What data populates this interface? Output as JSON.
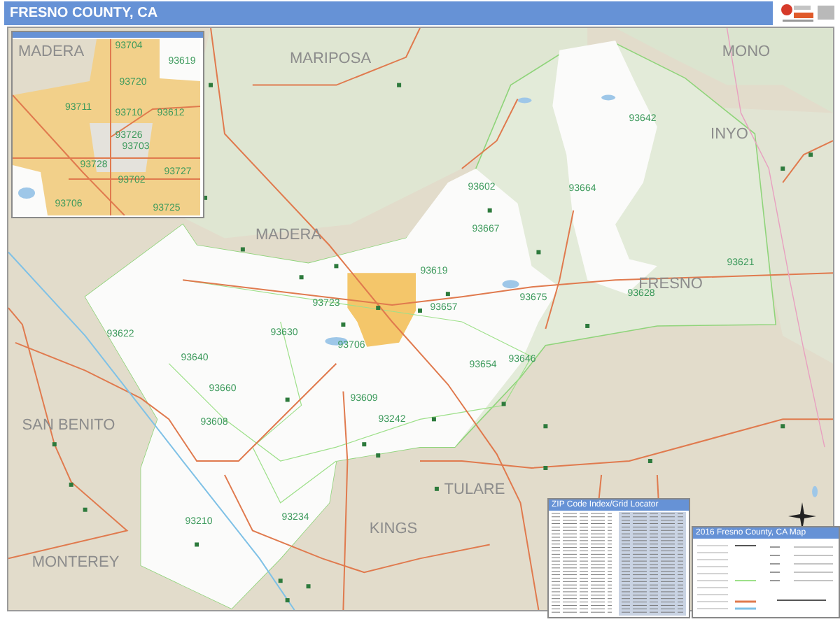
{
  "header": {
    "title": "FRESNO COUNTY, CA"
  },
  "map": {
    "region_labels": [
      {
        "text": "MARIPOSA"
      },
      {
        "text": "MONO"
      },
      {
        "text": "INYO"
      },
      {
        "text": "MADERA"
      },
      {
        "text": "FRESNO"
      },
      {
        "text": "SAN BENITO"
      },
      {
        "text": "TULARE"
      },
      {
        "text": "KINGS"
      },
      {
        "text": "MONTEREY"
      }
    ],
    "zip_labels": [
      {
        "text": "93642"
      },
      {
        "text": "93602"
      },
      {
        "text": "93664"
      },
      {
        "text": "93667"
      },
      {
        "text": "93621"
      },
      {
        "text": "93628"
      },
      {
        "text": "93619"
      },
      {
        "text": "93675"
      },
      {
        "text": "93657"
      },
      {
        "text": "93723"
      },
      {
        "text": "93622"
      },
      {
        "text": "93630"
      },
      {
        "text": "93706"
      },
      {
        "text": "93646"
      },
      {
        "text": "93640"
      },
      {
        "text": "93660"
      },
      {
        "text": "93609"
      },
      {
        "text": "93242"
      },
      {
        "text": "93608"
      },
      {
        "text": "93210"
      },
      {
        "text": "93234"
      },
      {
        "text": "93654"
      }
    ]
  },
  "inset": {
    "region_label": "MADERA",
    "zip_labels": [
      {
        "text": "93704"
      },
      {
        "text": "93619"
      },
      {
        "text": "93720"
      },
      {
        "text": "93711"
      },
      {
        "text": "93710"
      },
      {
        "text": "93612"
      },
      {
        "text": "93726"
      },
      {
        "text": "93703"
      },
      {
        "text": "93728"
      },
      {
        "text": "93727"
      },
      {
        "text": "93702"
      },
      {
        "text": "93706"
      },
      {
        "text": "93725"
      }
    ]
  },
  "index_panel": {
    "title": "ZIP Code Index/Grid Locator"
  },
  "legend_panel": {
    "title": "2016 Fresno County, CA Map"
  }
}
